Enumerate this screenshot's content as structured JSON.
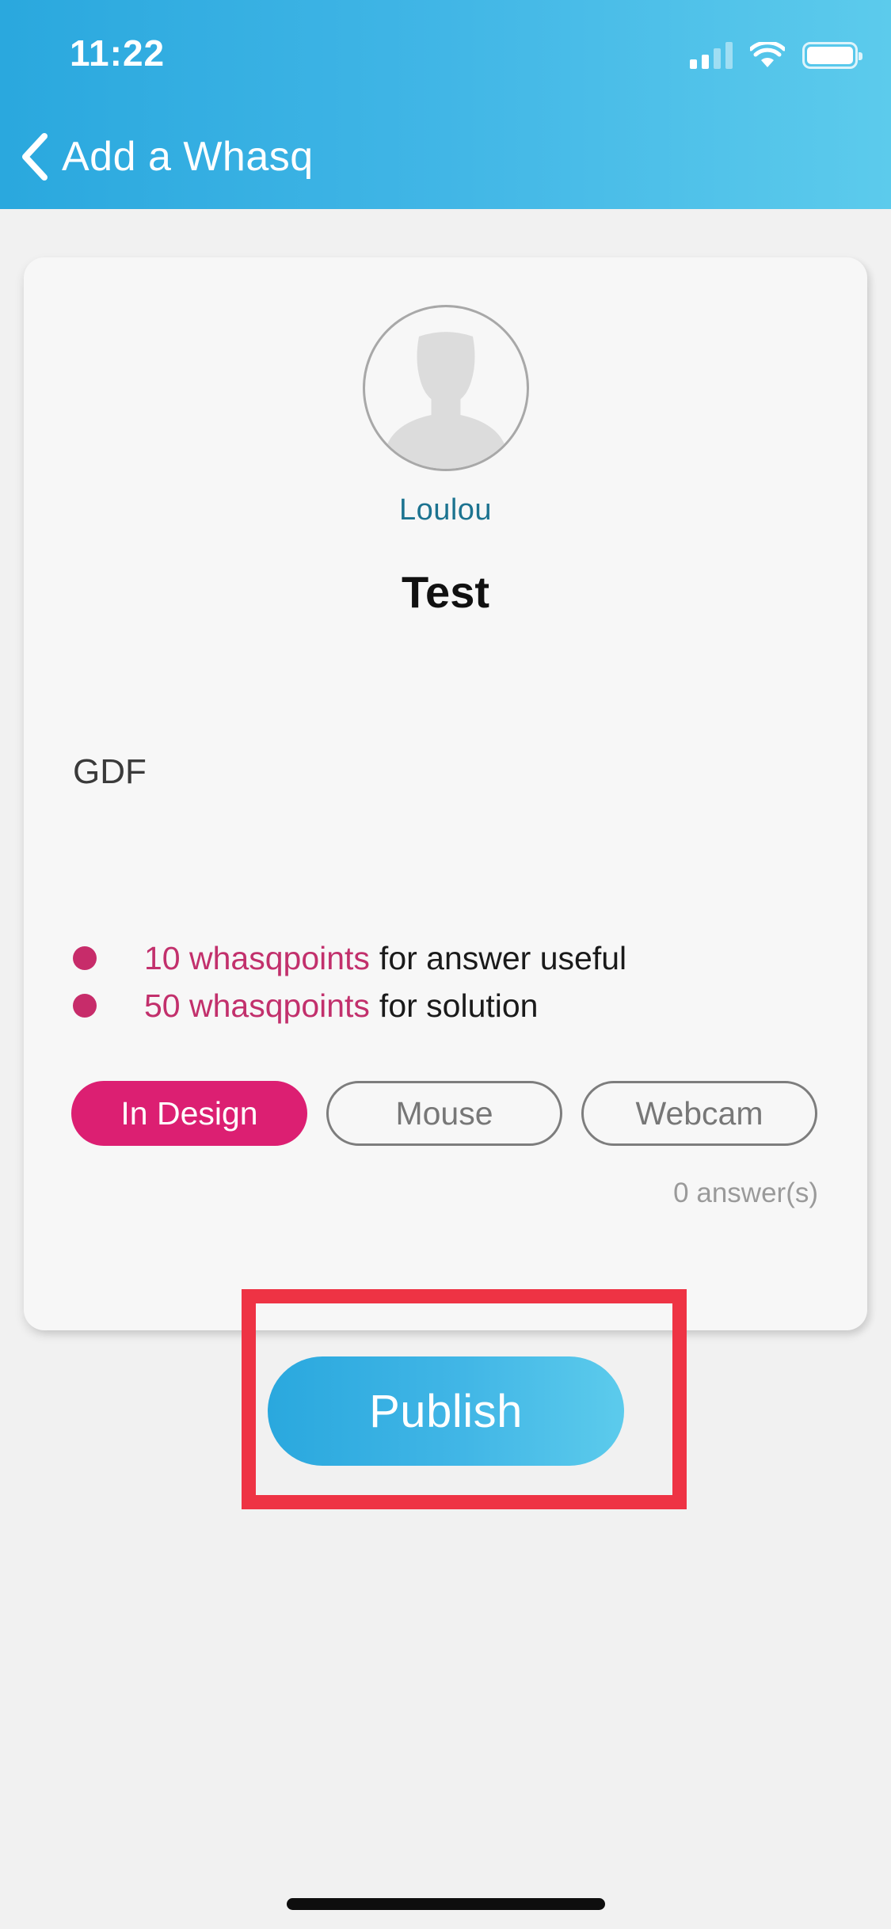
{
  "status_bar": {
    "time": "11:22"
  },
  "nav": {
    "back_title": "Add a Whasq"
  },
  "card": {
    "username": "Loulou",
    "title": "Test",
    "body": "GDF",
    "rewards": [
      {
        "points": "10 whasqpoints",
        "text": "for answer useful"
      },
      {
        "points": "50 whasqpoints",
        "text": "for solution"
      }
    ],
    "tags": [
      {
        "label": "In Design",
        "active": true
      },
      {
        "label": "Mouse",
        "active": false
      },
      {
        "label": "Webcam",
        "active": false
      }
    ],
    "answers": "0 answer(s)"
  },
  "publish": {
    "label": "Publish"
  },
  "colors": {
    "header_gradient_start": "#2aa8de",
    "header_gradient_end": "#5ccbec",
    "accent_pink": "#dc1f72",
    "points_pink": "#c2306c",
    "username_blue": "#1c7390",
    "highlight_red": "#ee3344"
  }
}
